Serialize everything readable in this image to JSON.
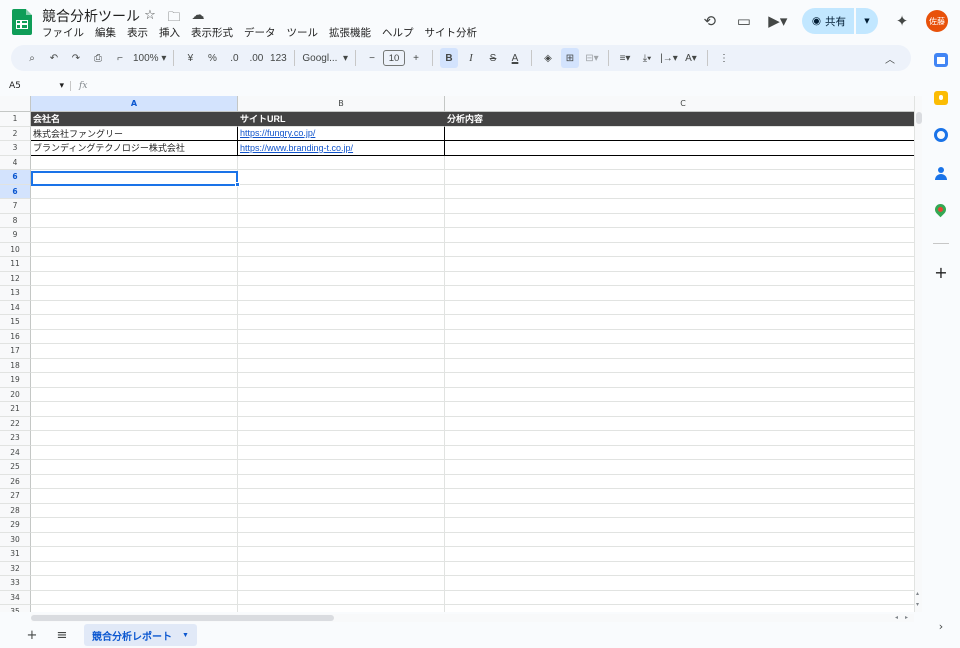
{
  "app": {
    "doc_title": "競合分析ツール",
    "menu": [
      "ファイル",
      "編集",
      "表示",
      "挿入",
      "表示形式",
      "データ",
      "ツール",
      "拡張機能",
      "ヘルプ",
      "サイト分析"
    ],
    "share_label": "共有",
    "avatar_text": "佐藤",
    "accent": "#0b57d0"
  },
  "toolbar": {
    "zoom": "100%",
    "currency": "¥",
    "percent": "%",
    "dec_decrease": ".0",
    "dec_increase": ".00",
    "number_format": "123",
    "font": "Googl...",
    "font_size": "10",
    "bold": "B",
    "italic": "I",
    "strike": "S",
    "text_color": "A"
  },
  "formula_bar": {
    "name_box": "A5",
    "fx": "fx"
  },
  "grid": {
    "columns": [
      "A",
      "B",
      "C"
    ],
    "selected_column": "A",
    "selected_row": "6",
    "rows": [
      {
        "n": "1",
        "cells": [
          "会社名",
          "サイトURL",
          "分析内容"
        ]
      },
      {
        "n": "2",
        "cells": [
          "株式会社ファングリー",
          "https://fungry.co.jp/",
          ""
        ]
      },
      {
        "n": "3",
        "cells": [
          "ブランディングテクノロジー株式会社",
          "https://www.branding-t.co.jp/",
          ""
        ]
      },
      {
        "n": "4",
        "cells": [
          "",
          "",
          ""
        ]
      },
      {
        "n": "6",
        "cells": [
          "",
          "",
          ""
        ]
      },
      {
        "n": "6",
        "cells": [
          "",
          "",
          ""
        ]
      },
      {
        "n": "7",
        "cells": [
          "",
          "",
          ""
        ]
      },
      {
        "n": "8",
        "cells": [
          "",
          "",
          ""
        ]
      },
      {
        "n": "9",
        "cells": [
          "",
          "",
          ""
        ]
      },
      {
        "n": "10",
        "cells": [
          "",
          "",
          ""
        ]
      },
      {
        "n": "11",
        "cells": [
          "",
          "",
          ""
        ]
      },
      {
        "n": "12",
        "cells": [
          "",
          "",
          ""
        ]
      },
      {
        "n": "13",
        "cells": [
          "",
          "",
          ""
        ]
      },
      {
        "n": "14",
        "cells": [
          "",
          "",
          ""
        ]
      },
      {
        "n": "15",
        "cells": [
          "",
          "",
          ""
        ]
      },
      {
        "n": "16",
        "cells": [
          "",
          "",
          ""
        ]
      },
      {
        "n": "17",
        "cells": [
          "",
          "",
          ""
        ]
      },
      {
        "n": "18",
        "cells": [
          "",
          "",
          ""
        ]
      },
      {
        "n": "19",
        "cells": [
          "",
          "",
          ""
        ]
      },
      {
        "n": "20",
        "cells": [
          "",
          "",
          ""
        ]
      },
      {
        "n": "21",
        "cells": [
          "",
          "",
          ""
        ]
      },
      {
        "n": "22",
        "cells": [
          "",
          "",
          ""
        ]
      },
      {
        "n": "23",
        "cells": [
          "",
          "",
          ""
        ]
      },
      {
        "n": "24",
        "cells": [
          "",
          "",
          ""
        ]
      },
      {
        "n": "25",
        "cells": [
          "",
          "",
          ""
        ]
      },
      {
        "n": "26",
        "cells": [
          "",
          "",
          ""
        ]
      },
      {
        "n": "27",
        "cells": [
          "",
          "",
          ""
        ]
      },
      {
        "n": "28",
        "cells": [
          "",
          "",
          ""
        ]
      },
      {
        "n": "29",
        "cells": [
          "",
          "",
          ""
        ]
      },
      {
        "n": "30",
        "cells": [
          "",
          "",
          ""
        ]
      },
      {
        "n": "31",
        "cells": [
          "",
          "",
          ""
        ]
      },
      {
        "n": "32",
        "cells": [
          "",
          "",
          ""
        ]
      },
      {
        "n": "33",
        "cells": [
          "",
          "",
          ""
        ]
      },
      {
        "n": "34",
        "cells": [
          "",
          "",
          ""
        ]
      },
      {
        "n": "35",
        "cells": [
          "",
          "",
          ""
        ]
      }
    ]
  },
  "sheets": {
    "active_tab": "競合分析レポート"
  },
  "icons": {
    "header": [
      "history-icon",
      "comment-icon",
      "video-call-icon",
      "gemini-icon"
    ],
    "side_panel": [
      "calendar-icon",
      "keep-icon",
      "tasks-icon",
      "contacts-icon",
      "maps-icon",
      "add-icon",
      "expand-icon"
    ]
  }
}
